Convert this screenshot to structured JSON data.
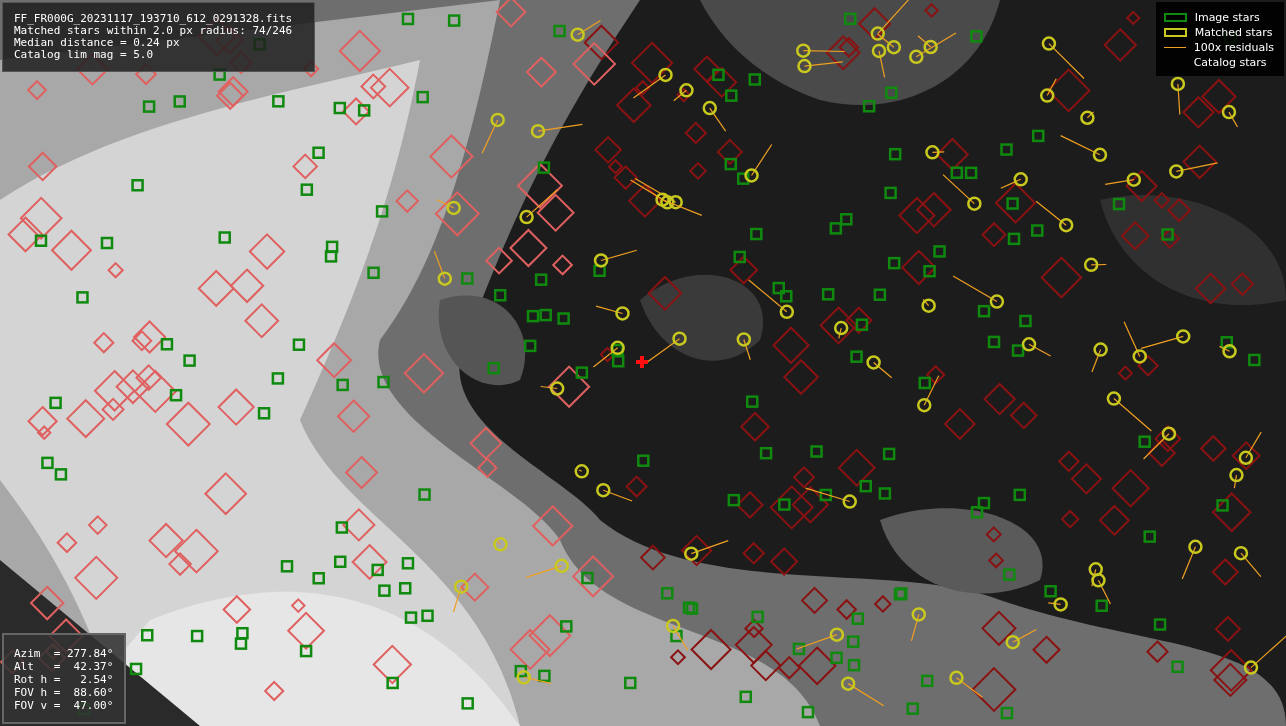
{
  "info_panel": {
    "lines": [
      "FF_FR000G_20231117_193710_612_0291328.fits",
      "Matched stars within 2.0 px radius: 74/246",
      "Median distance = 0.24 px",
      "Catalog lim mag = 5.0"
    ]
  },
  "legend": {
    "items": [
      {
        "label": "Image stars"
      },
      {
        "kind": "matched",
        "label": "Matched stars"
      },
      {
        "kind": "residual",
        "label": "100x residuals"
      },
      {
        "kind": "catalog",
        "label": "Catalog stars"
      }
    ]
  },
  "pointing_panel": {
    "lines": [
      "Azim  = 277.84°",
      "Alt   =  42.37°",
      "Rot h =   2.54°",
      "FOV h =  88.60°",
      "FOV v =  47.00°"
    ]
  }
}
